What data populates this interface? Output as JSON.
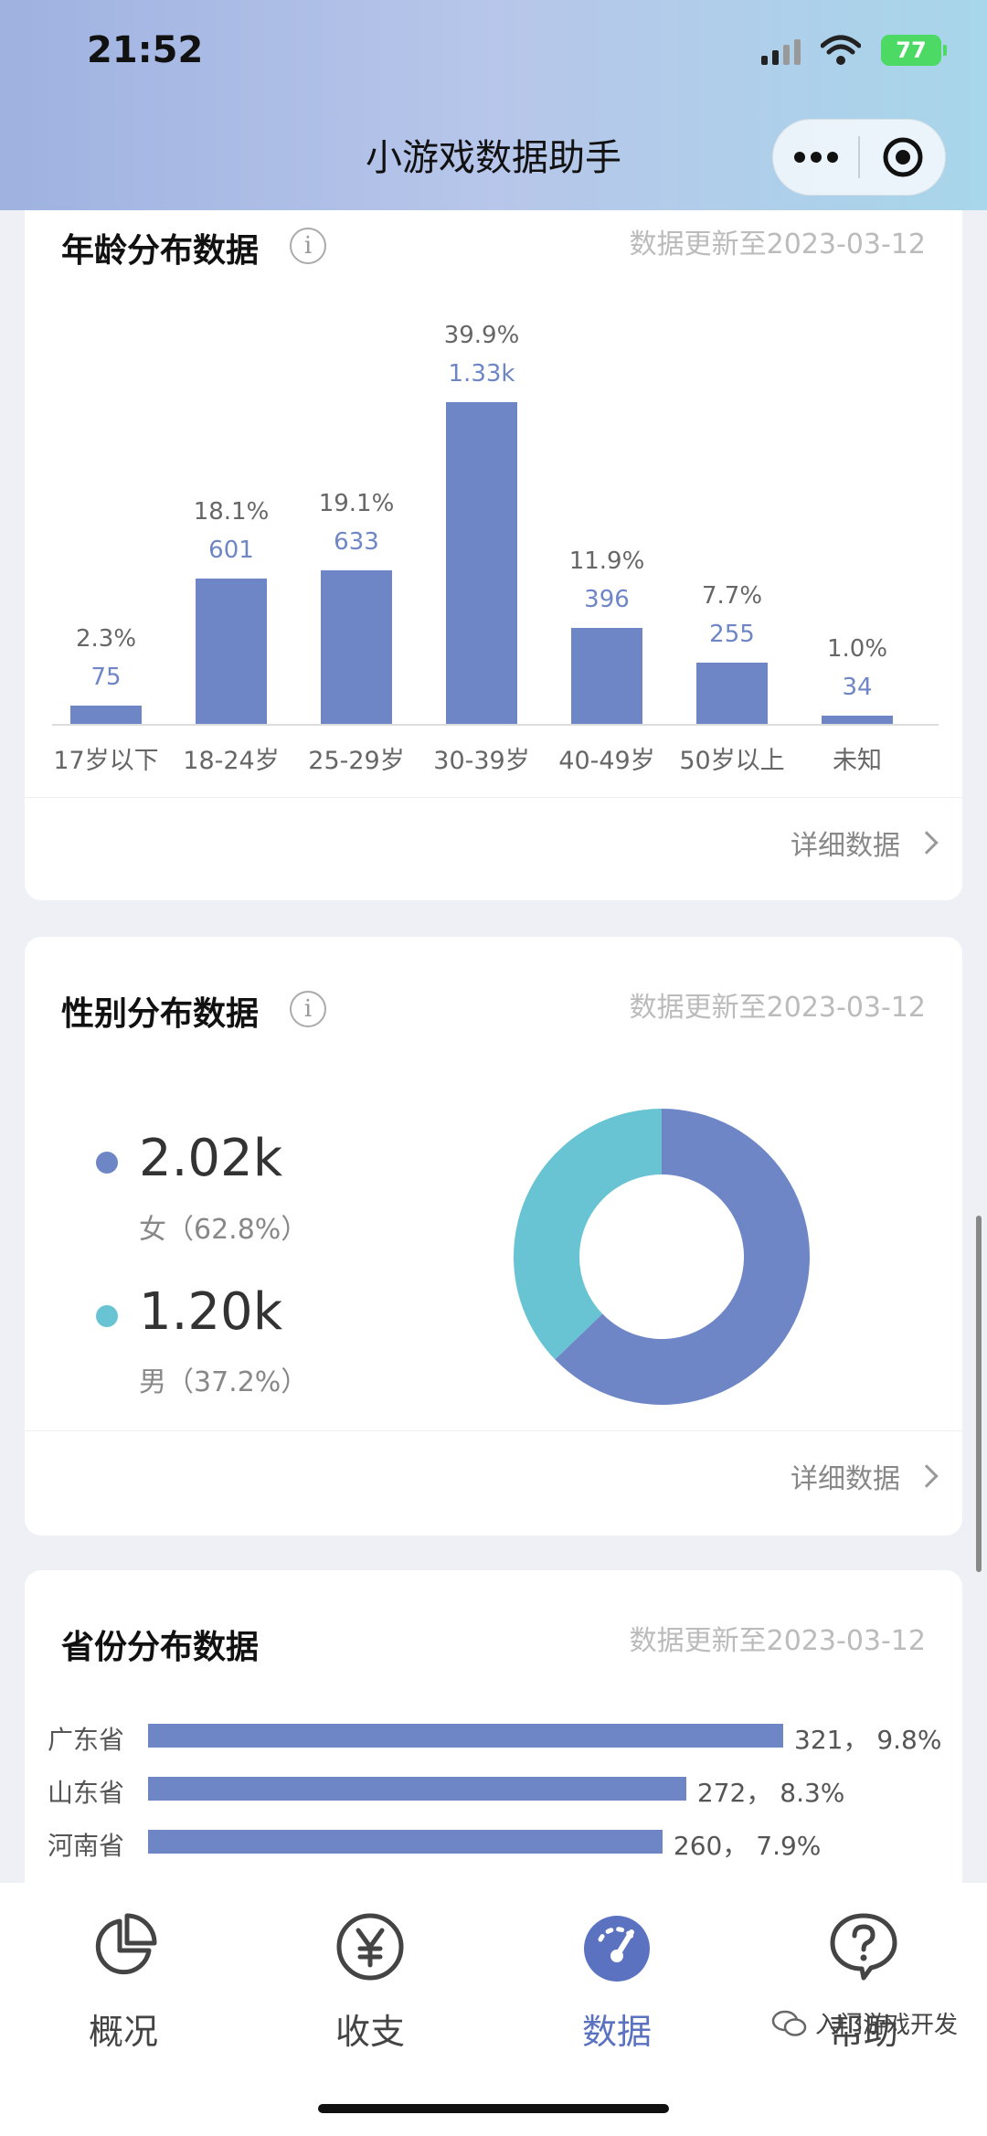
{
  "status_bar": {
    "time": "21:52",
    "battery": "77"
  },
  "header": {
    "title": "小游戏数据助手"
  },
  "age_card": {
    "title": "年龄分布数据",
    "update": "数据更新至2023-03-12",
    "detail": "详细数据"
  },
  "gender_card": {
    "title": "性别分布数据",
    "update": "数据更新至2023-03-12",
    "detail": "详细数据",
    "female_value": "2.02k",
    "female_label": "女（62.8%）",
    "male_value": "1.20k",
    "male_label": "男（37.2%）"
  },
  "province_card": {
    "title": "省份分布数据",
    "update": "数据更新至2023-03-12"
  },
  "tabs": [
    {
      "label": "概况",
      "icon": "pie-chart-icon"
    },
    {
      "label": "收支",
      "icon": "yen-icon"
    },
    {
      "label": "数据",
      "icon": "gauge-icon"
    },
    {
      "label": "帮助",
      "icon": "help-icon"
    }
  ],
  "watermark": "入门游戏开发",
  "colors": {
    "primary": "#6e86c5",
    "secondary": "#68c4d2"
  },
  "chart_data": [
    {
      "type": "bar",
      "categories": [
        "17岁以下",
        "18-24岁",
        "25-29岁",
        "30-39岁",
        "40-49岁",
        "50岁以上",
        "未知"
      ],
      "values": [
        75,
        601,
        633,
        1330
      ],
      "value_labels": [
        "75",
        "601",
        "633",
        "1.33k"
      ],
      "percent_labels": [
        "2.3%",
        "18.1%",
        "19.1%",
        "39.9%"
      ],
      "values_rest": [
        396,
        255,
        34
      ],
      "value_labels_rest": [
        "396",
        "255",
        "34"
      ],
      "percent_labels_rest": [
        "11.9%",
        "7.7%",
        "1.0%"
      ]
    },
    {
      "type": "pie",
      "labels": [
        "女",
        "男"
      ],
      "values": [
        62.8,
        37.2
      ],
      "colors": [
        "#6e86c5",
        "#68c4d2"
      ]
    },
    {
      "type": "bar",
      "categories": [
        "广东省",
        "山东省",
        "河南省"
      ],
      "values": [
        321,
        272,
        260
      ],
      "percent_labels": [
        "9.8%",
        "8.3%",
        "7.9%"
      ]
    }
  ]
}
